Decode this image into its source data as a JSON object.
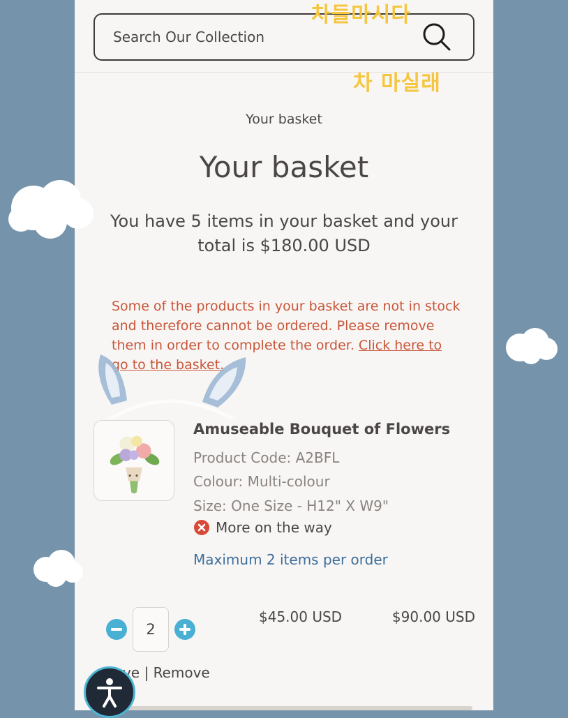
{
  "search": {
    "placeholder": "Search Our Collection"
  },
  "breadcrumb": "Your basket",
  "page_title": "Your basket",
  "summary": "You have 5 items in your basket and your total is $180.00 USD",
  "warning": {
    "text": "Some of the products in your basket are not in stock and therefore cannot be ordered. Please remove them in order to complete the order.",
    "link": "Click here to go to the basket."
  },
  "product": {
    "name": "Amuseable Bouquet of Flowers",
    "code": "Product Code: A2BFL",
    "colour": "Colour: Multi-colour",
    "size": "Size: One Size - H12\" X W9\"",
    "stock_status": "More on the way",
    "limit_note": "Maximum 2 items per order",
    "quantity": "2",
    "unit_price": "$45.00 USD",
    "line_total": "$90.00 USD",
    "save_label": "Save",
    "remove_label": "Remove",
    "separator": "|"
  },
  "stickers": {
    "top": "차들마시다",
    "bottom": "차 마실래"
  },
  "colors": {
    "background": "#7593ab",
    "page": "#f8f6f4",
    "text": "#4a4645",
    "warning": "#c9563a",
    "link": "#3d6e9b",
    "qty_button": "#49b0d3",
    "sticker": "#f5c640"
  },
  "icons": [
    "search-icon",
    "out-of-stock-icon",
    "minus-icon",
    "plus-icon",
    "accessibility-icon"
  ]
}
